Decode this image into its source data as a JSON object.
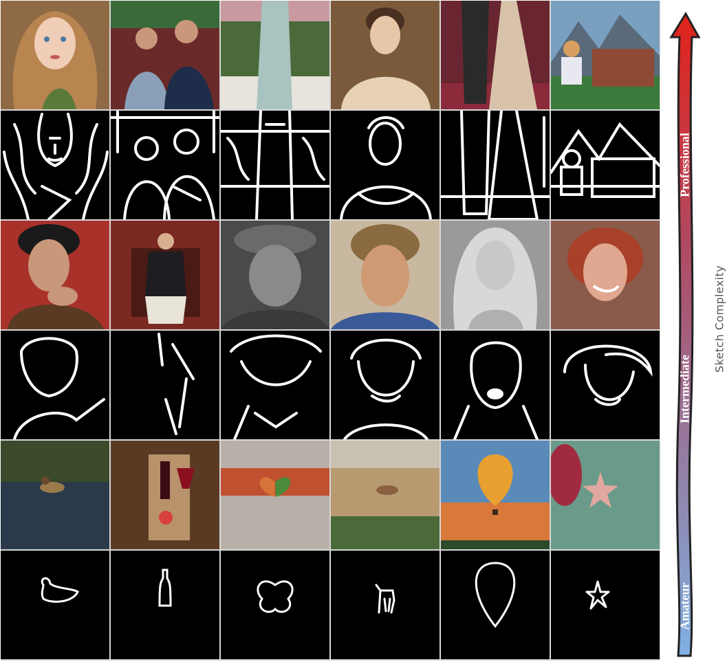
{
  "figure": {
    "y_axis_label": "Sketch Complexity",
    "levels": [
      "Professional",
      "Intermediate",
      "Amateur"
    ],
    "colors": {
      "top": "#e2231a",
      "middle": "#9a6e8f",
      "bottom": "#7fb0e2",
      "outline": "#222222",
      "sketch_bg": "#000000",
      "stroke": "#ffffff"
    }
  },
  "rows": [
    {
      "kind": "photo",
      "level": "Professional",
      "items": [
        {
          "subject": "girl-long-wavy-hair",
          "bg": "#8e6a45",
          "fg": "#c08a55"
        },
        {
          "subject": "two-men-seated",
          "bg": "#6b2a2a",
          "fg": "#3c5a7a"
        },
        {
          "subject": "woman-long-dress",
          "bg": "#c89aa0",
          "fg": "#a9c3c0"
        },
        {
          "subject": "woman-portrait-painting",
          "bg": "#7a5a3a",
          "fg": "#e7d2b5"
        },
        {
          "subject": "couple-red-carpet",
          "bg": "#6a2630",
          "fg": "#d8c2a9"
        },
        {
          "subject": "girl-viewing-mountains",
          "bg": "#3b5b7a",
          "fg": "#8e4a35"
        }
      ]
    },
    {
      "kind": "sketch",
      "level": "Professional",
      "items": [
        "girl-long-wavy-hair-sketch",
        "two-men-seated-sketch",
        "woman-long-dress-sketch",
        "woman-portrait-painting-sketch",
        "couple-red-carpet-sketch",
        "girl-viewing-mountains-sketch"
      ]
    },
    {
      "kind": "photo",
      "level": "Intermediate",
      "items": [
        {
          "subject": "man-hand-on-chin",
          "bg": "#a8322a",
          "fg": "#5a3a22"
        },
        {
          "subject": "man-seated-armchair",
          "bg": "#7a2a22",
          "fg": "#1e1e22"
        },
        {
          "subject": "old-man-headwrap",
          "bg": "#4a4a4a",
          "fg": "#8a8a8a"
        },
        {
          "subject": "man-curly-hair",
          "bg": "#c8b8a0",
          "fg": "#c2875a"
        },
        {
          "subject": "woman-blonde-bw",
          "bg": "#9a9a9a",
          "fg": "#d8d8d8"
        },
        {
          "subject": "woman-red-short-hair",
          "bg": "#8a5a4a",
          "fg": "#e0a890"
        }
      ]
    },
    {
      "kind": "sketch",
      "level": "Intermediate",
      "items": [
        "man-hand-on-chin-sketch",
        "man-seated-armchair-sketch",
        "old-man-headwrap-sketch",
        "man-curly-hair-sketch",
        "woman-blonde-bw-sketch",
        "woman-red-short-hair-sketch"
      ]
    },
    {
      "kind": "photo",
      "level": "Amateur",
      "items": [
        {
          "subject": "duck-on-water",
          "bg": "#3a4a2a",
          "fg": "#9a7a4a"
        },
        {
          "subject": "wine-bottle-glass",
          "bg": "#5a3a22",
          "fg": "#3a0c12"
        },
        {
          "subject": "butterfly",
          "bg": "#b8b0a8",
          "fg": "#d8743a"
        },
        {
          "subject": "deer-in-field",
          "bg": "#b89a70",
          "fg": "#8a6040"
        },
        {
          "subject": "hot-air-balloon",
          "bg": "#d8783a",
          "fg": "#3a8ad8"
        },
        {
          "subject": "starfish",
          "bg": "#6a9a8a",
          "fg": "#e0a8a0"
        }
      ]
    },
    {
      "kind": "sketch",
      "level": "Amateur",
      "items": [
        "duck-sketch",
        "bottle-sketch",
        "butterfly-sketch",
        "deer-sketch",
        "balloon-sketch",
        "starfish-sketch"
      ]
    }
  ]
}
